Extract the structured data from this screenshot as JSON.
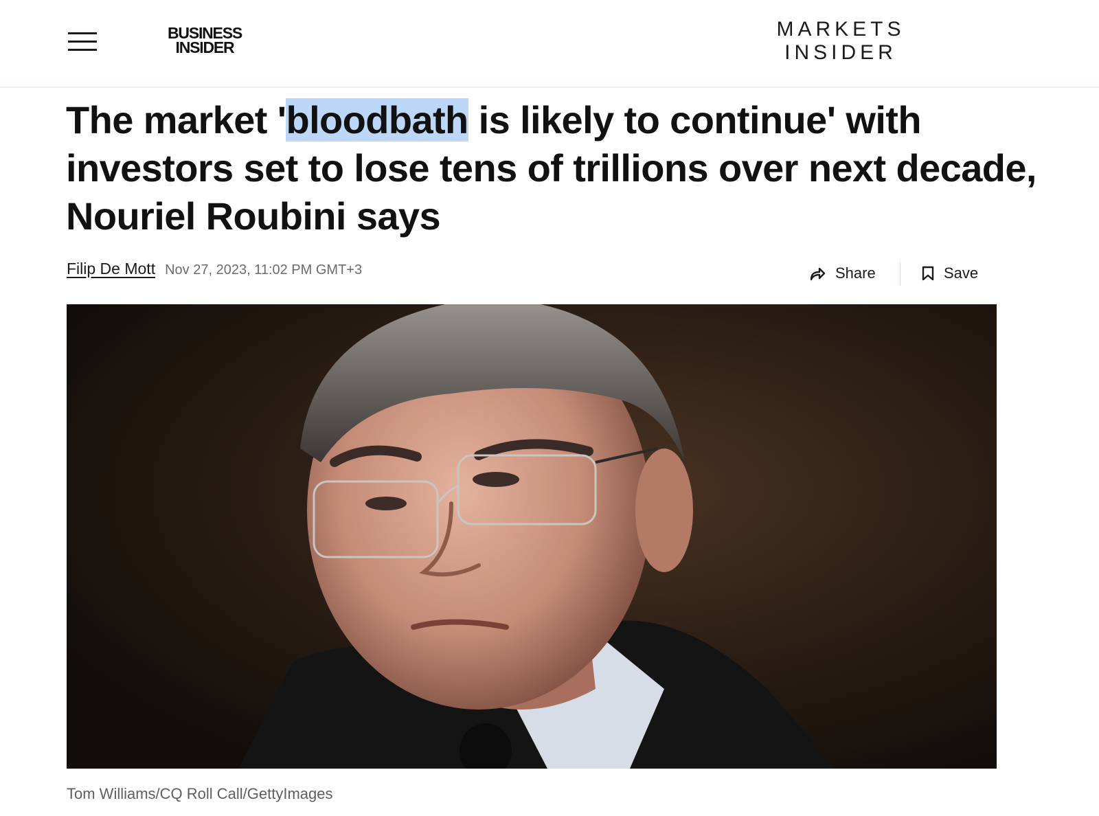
{
  "header": {
    "menu_icon": "hamburger-menu-icon",
    "brand_logo": {
      "line1": "BUSINESS",
      "line2": "INSIDER"
    },
    "section_logo": {
      "line1": "MARKETS",
      "line2": "INSIDER"
    }
  },
  "article": {
    "headline_before": "The market '",
    "headline_highlight": "bloodbath",
    "headline_after": " is likely to continue' with investors set to lose tens of trillions over next decade, Nouriel Roubini says",
    "author": "Filip De Mott",
    "timestamp": "Nov 27, 2023, 11:02 PM GMT+3",
    "share_label": "Share",
    "share_icon": "share-arrow-icon",
    "save_label": "Save",
    "save_icon": "bookmark-icon",
    "image_caption": "Tom Williams/CQ Roll Call/GettyImages"
  },
  "colors": {
    "highlight": "#bcd7f7",
    "text": "#111111",
    "muted": "#6b6b6b",
    "header_border": "#e6eef2"
  }
}
